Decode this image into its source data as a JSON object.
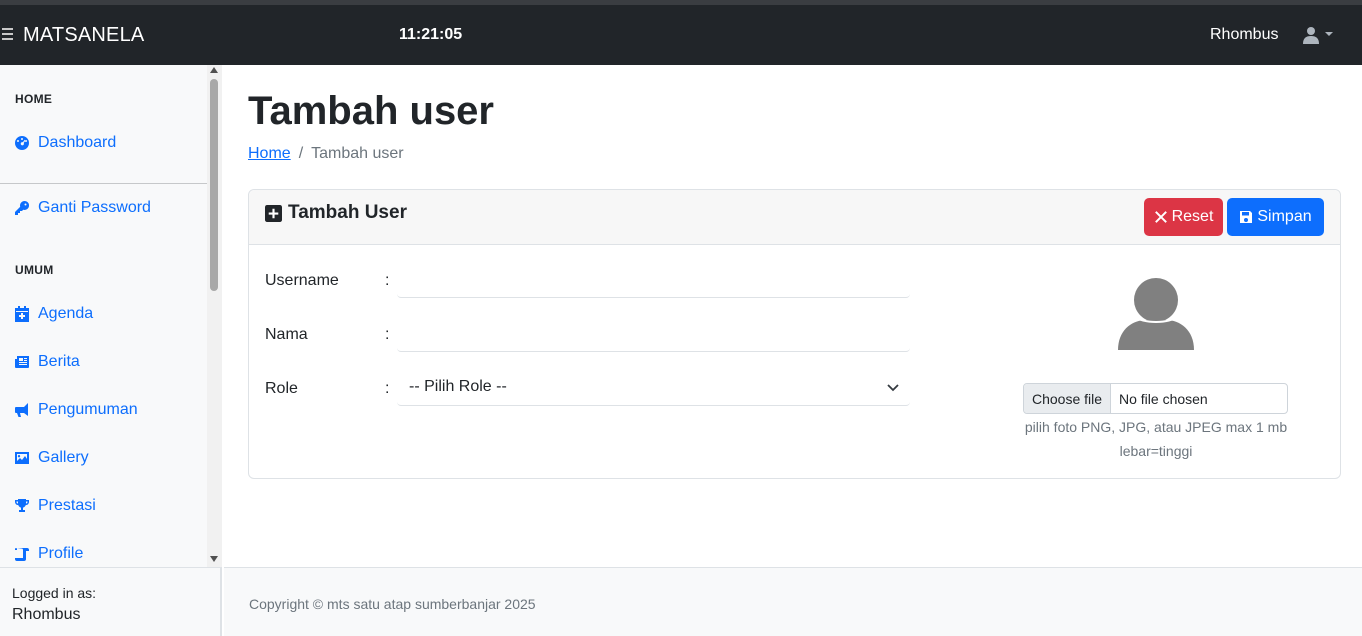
{
  "navbar": {
    "brand": "MATSANELA",
    "clock": "11:21:05",
    "user_name": "Rhombus",
    "menu_icon": "hamburger-icon",
    "user_icon": "user-icon"
  },
  "sidebar": {
    "sections": [
      {
        "heading": "HOME",
        "items": [
          {
            "label": "Dashboard",
            "icon": "dashboard-gauge-icon"
          }
        ]
      },
      {
        "heading": "",
        "items": [
          {
            "label": "Ganti Password",
            "icon": "key-icon"
          }
        ]
      },
      {
        "heading": "UMUM",
        "items": [
          {
            "label": "Agenda",
            "icon": "calendar-plus-icon"
          },
          {
            "label": "Berita",
            "icon": "newspaper-icon"
          },
          {
            "label": "Pengumuman",
            "icon": "megaphone-icon"
          },
          {
            "label": "Gallery",
            "icon": "image-icon"
          },
          {
            "label": "Prestasi",
            "icon": "trophy-icon"
          },
          {
            "label": "Profile",
            "icon": "scroll-icon"
          }
        ]
      }
    ],
    "footer": {
      "label": "Logged in as:",
      "user": "Rhombus"
    }
  },
  "page": {
    "title": "Tambah user",
    "breadcrumb": {
      "home": "Home",
      "separator": "/",
      "current": "Tambah user"
    }
  },
  "card": {
    "title": "Tambah User",
    "title_icon": "plus-square-icon",
    "reset_label": "Reset",
    "save_label": "Simpan",
    "form": {
      "username": {
        "label": "Username",
        "colon": ":",
        "value": ""
      },
      "nama": {
        "label": "Nama",
        "colon": ":",
        "value": ""
      },
      "role": {
        "label": "Role",
        "colon": ":",
        "selected": "-- Pilih Role --"
      }
    },
    "photo": {
      "choose_label": "Choose file",
      "status": "No file chosen",
      "help_line1": "pilih foto PNG, JPG, atau JPEG max 1 mb",
      "help_line2": "lebar=tinggi"
    }
  },
  "footer": {
    "text": "Copyright © mts satu atap sumberbanjar 2025"
  },
  "colors": {
    "navbar": "#212529",
    "link": "#0d6efd",
    "danger": "#dc3545",
    "primary": "#0d6efd"
  }
}
